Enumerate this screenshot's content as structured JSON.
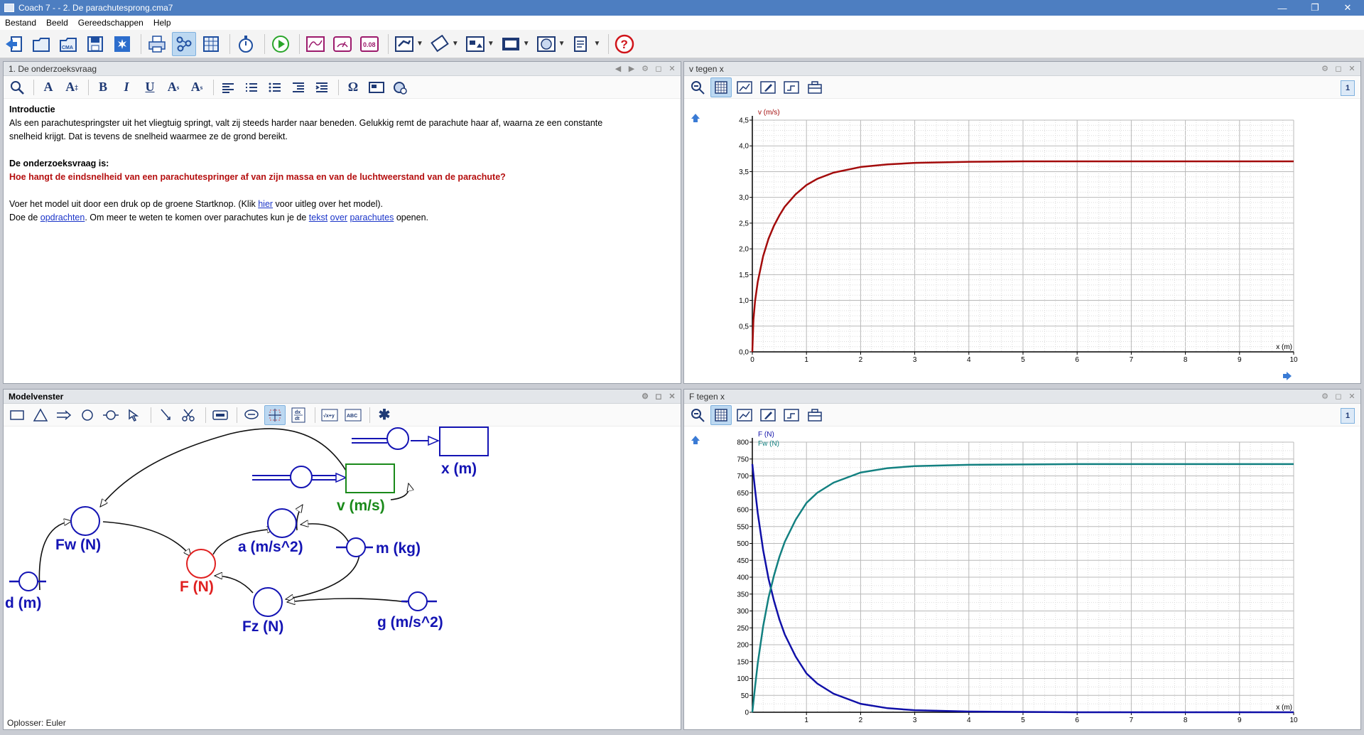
{
  "window": {
    "title": "Coach 7 -  - 2. De parachutesprong.cma7",
    "minimize": "—",
    "restore": "❐",
    "close": "✕"
  },
  "menu": [
    "Bestand",
    "Beeld",
    "Gereedschappen",
    "Help"
  ],
  "toolbar": {
    "time_value": "0.08"
  },
  "text_panel": {
    "title": "1. De onderzoeksvraag",
    "heading": "Introductie",
    "intro_line1": "Als een parachutespringster uit het vliegtuig springt, valt zij steeds harder naar beneden. Gelukkig remt de parachute haar af, waarna ze een constante",
    "intro_line2": "snelheid krijgt. Dat is tevens de snelheid waarmee ze de grond bereikt.",
    "question_label": "De onderzoeksvraag is:",
    "question": "Hoe hangt de eindsnelheid van een parachutespringer af van zijn massa en van de luchtweerstand van de parachute?",
    "line3_a": "Voer het model uit door een druk op de groene Startknop. (Klik ",
    "line3_link": "hier",
    "line3_b": " voor uitleg over het model).",
    "line4_a": "Doe de ",
    "line4_link1": "opdrachten",
    "line4_b": ". Om meer te weten te komen over parachutes kun je de ",
    "line4_link2": "tekst",
    "line4_link3": "over",
    "line4_link4": "parachutes",
    "line4_c": " openen."
  },
  "graph1": {
    "title": "v tegen x",
    "page": "1"
  },
  "graph2": {
    "title": "F tegen x",
    "page": "1"
  },
  "model": {
    "title": "Modelvenster",
    "solver": "Oplosser: Euler",
    "labels": {
      "x": "x (m)",
      "v": "v (m/s)",
      "fw": "Fw (N)",
      "a": "a (m/s^2)",
      "m": "m (kg)",
      "f": "F (N)",
      "d": "d (m)",
      "fz": "Fz (N)",
      "g": "g (m/s^2)"
    },
    "colors": {
      "blue": "#1414b4",
      "green": "#1a8a1a",
      "red": "#e02020"
    }
  },
  "chart_data": [
    {
      "type": "line",
      "title": "v tegen x",
      "xlabel": "x (m)",
      "ylabel": "v (m/s)",
      "xlim": [
        0,
        10
      ],
      "ylim": [
        0,
        4.5
      ],
      "xticks": [
        "0",
        "1",
        "2",
        "3",
        "4",
        "5",
        "6",
        "7",
        "8",
        "9",
        "10"
      ],
      "yticks": [
        "0,0",
        "0,5",
        "1,0",
        "1,5",
        "2,0",
        "2,5",
        "3,0",
        "3,5",
        "4,0",
        "4,5"
      ],
      "grid": true,
      "series": [
        {
          "name": "v (m/s)",
          "color": "#a30b0b",
          "x": [
            0,
            0.02,
            0.05,
            0.1,
            0.2,
            0.3,
            0.4,
            0.5,
            0.6,
            0.8,
            1.0,
            1.2,
            1.5,
            2.0,
            2.5,
            3.0,
            4.0,
            5.0,
            6.0,
            7.0,
            8.0,
            9.0,
            10.0
          ],
          "y": [
            0,
            0.62,
            0.98,
            1.36,
            1.86,
            2.2,
            2.45,
            2.65,
            2.82,
            3.06,
            3.24,
            3.36,
            3.48,
            3.59,
            3.64,
            3.67,
            3.69,
            3.7,
            3.7,
            3.7,
            3.7,
            3.7,
            3.7
          ]
        }
      ]
    },
    {
      "type": "line",
      "title": "F tegen x",
      "xlabel": "x (m)",
      "xlim": [
        0,
        10
      ],
      "ylim": [
        0,
        800
      ],
      "xticks": [
        "1",
        "2",
        "3",
        "4",
        "5",
        "6",
        "7",
        "8",
        "9",
        "10"
      ],
      "yticks": [
        "0",
        "50",
        "100",
        "150",
        "200",
        "250",
        "300",
        "350",
        "400",
        "450",
        "500",
        "550",
        "600",
        "650",
        "700",
        "750",
        "800"
      ],
      "grid": true,
      "series": [
        {
          "name": "F (N)",
          "color": "#1010a8",
          "x": [
            0,
            0.05,
            0.1,
            0.2,
            0.3,
            0.4,
            0.5,
            0.6,
            0.8,
            1.0,
            1.2,
            1.5,
            2.0,
            2.5,
            3.0,
            4.0,
            5.0,
            6.0,
            7.0,
            8.0,
            9.0,
            10.0
          ],
          "y": [
            735,
            660,
            590,
            480,
            395,
            330,
            275,
            230,
            165,
            115,
            85,
            55,
            25,
            12,
            6,
            2,
            1,
            0,
            0,
            0,
            0,
            0
          ]
        },
        {
          "name": "Fw (N)",
          "color": "#128080",
          "x": [
            0,
            0.05,
            0.1,
            0.2,
            0.3,
            0.4,
            0.5,
            0.6,
            0.8,
            1.0,
            1.2,
            1.5,
            2.0,
            2.5,
            3.0,
            4.0,
            5.0,
            6.0,
            7.0,
            8.0,
            9.0,
            10.0
          ],
          "y": [
            0,
            75,
            145,
            255,
            340,
            405,
            460,
            505,
            570,
            620,
            650,
            680,
            710,
            723,
            729,
            733,
            734,
            735,
            735,
            735,
            735,
            735
          ]
        }
      ]
    }
  ]
}
